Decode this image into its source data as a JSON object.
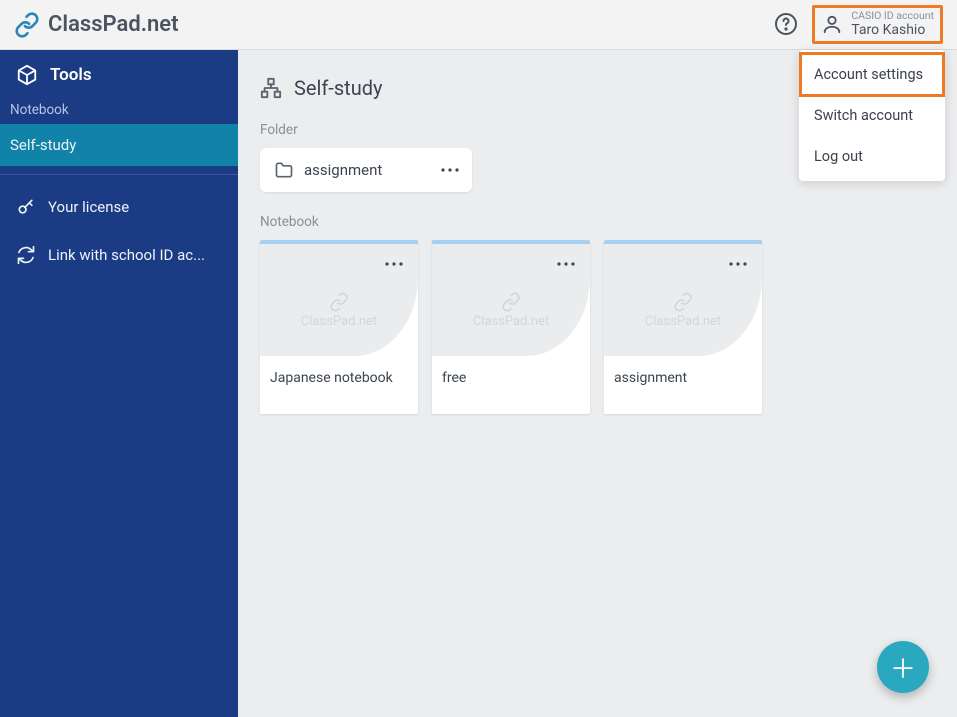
{
  "brand": {
    "text": "ClassPad.net"
  },
  "header": {
    "account_label": "CASIO ID account",
    "user_name": "Taro Kashio"
  },
  "account_menu": {
    "items": [
      "Account settings",
      "Switch account",
      "Log out"
    ],
    "highlighted_index": 0
  },
  "sidebar": {
    "header": "Tools",
    "sublabel": "Notebook",
    "active_item": "Self-study",
    "links": [
      "Your license",
      "Link with school ID ac..."
    ]
  },
  "main": {
    "title": "Self-study",
    "folder_section_label": "Folder",
    "folders": [
      {
        "name": "assignment"
      }
    ],
    "notebook_section_label": "Notebook",
    "notebooks": [
      {
        "name": "Japanese notebook",
        "watermark": "ClassPad.net"
      },
      {
        "name": "free",
        "watermark": "ClassPad.net"
      },
      {
        "name": "assignment",
        "watermark": "ClassPad.net"
      }
    ]
  },
  "icons": {
    "brand": "link-chain-icon",
    "help": "help-circle-icon",
    "user": "user-icon",
    "tools": "box-icon",
    "key": "key-icon",
    "sync": "sync-icon",
    "page_title": "hierarchy-icon",
    "folder": "folder-icon",
    "more": "more-horizontal-icon",
    "fab": "plus-icon"
  }
}
